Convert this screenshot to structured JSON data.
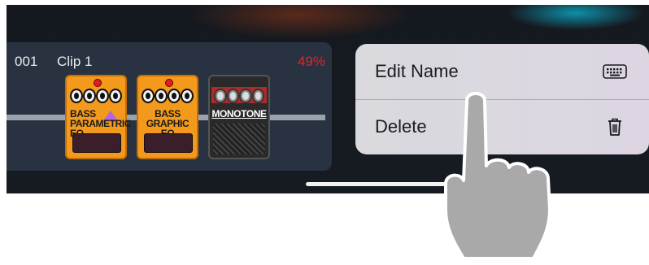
{
  "clip": {
    "number": "001",
    "name": "Clip 1",
    "percent": "49%"
  },
  "pedals": [
    {
      "line1": "BASS",
      "line2": "PARAMETRIC EQ"
    },
    {
      "line1": "BASS",
      "line2": "GRAPHIC EQ"
    },
    {
      "line1": "MONOTONE"
    }
  ],
  "menu": {
    "edit_name": "Edit Name",
    "edit_icon": "keyboard-icon",
    "delete": "Delete",
    "delete_icon": "trash-icon"
  },
  "colors": {
    "percent": "#e0262a",
    "pedal_orange": "#f39a1c",
    "card_bg": "#283240"
  }
}
